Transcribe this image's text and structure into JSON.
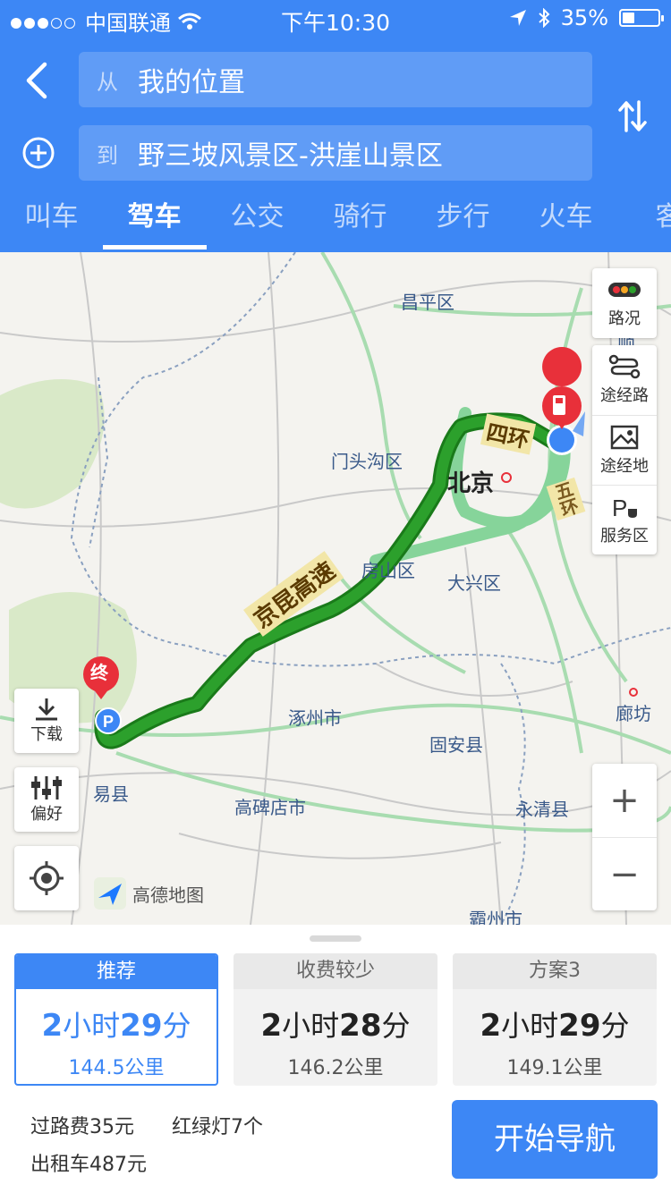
{
  "status": {
    "carrier": "中国联通",
    "time": "下午10:30",
    "battery_percent": "35%",
    "battery_level": 0.35
  },
  "route": {
    "from_prefix": "从",
    "from_value": "我的位置",
    "to_prefix": "到",
    "to_value": "野三坡风景区-洪崖山景区"
  },
  "tabs": [
    "叫车",
    "驾车",
    "公交",
    "骑行",
    "步行",
    "火车",
    "客"
  ],
  "active_tab": "驾车",
  "map": {
    "labels": {
      "changping": "昌平区",
      "mentougou": "门头沟区",
      "beijing": "北京",
      "fangshan": "房山区",
      "daxing": "大兴区",
      "zhuozhou": "涿州市",
      "guan": "固安县",
      "langfang": "廊坊",
      "yixian": "易县",
      "gaobeidian": "高碑店市",
      "yongqing": "永清县",
      "bazhou": "霸州市",
      "shun": "顺"
    },
    "road_labels": {
      "jingkun": "京昆高速",
      "sihuan": "四环",
      "wuhuan": "五环"
    },
    "end_marker": "终",
    "logo": "高德地图",
    "controls": {
      "traffic": "路况",
      "waypoint_road": "途经路",
      "waypoint_place": "途经地",
      "service_area": "服务区",
      "download": "下载",
      "preference": "偏好",
      "zoom_in": "+",
      "zoom_out": "−"
    }
  },
  "plans": [
    {
      "tag": "推荐",
      "hours": "2",
      "hour_unit": "小时",
      "minutes": "29",
      "minute_unit": "分",
      "distance": "144.5公里",
      "selected": true
    },
    {
      "tag": "收费较少",
      "hours": "2",
      "hour_unit": "小时",
      "minutes": "28",
      "minute_unit": "分",
      "distance": "146.2公里",
      "selected": false
    },
    {
      "tag": "方案3",
      "hours": "2",
      "hour_unit": "小时",
      "minutes": "29",
      "minute_unit": "分",
      "distance": "149.1公里",
      "selected": false
    }
  ],
  "summary": {
    "toll": "过路费35元",
    "lights": "红绿灯7个",
    "taxi": "出租车487元"
  },
  "start_nav": "开始导航",
  "colors": {
    "brand_blue": "#3d87f5",
    "route_green": "#2ca02c",
    "alt_route": "#86d49a",
    "marker_red": "#e8303a"
  }
}
